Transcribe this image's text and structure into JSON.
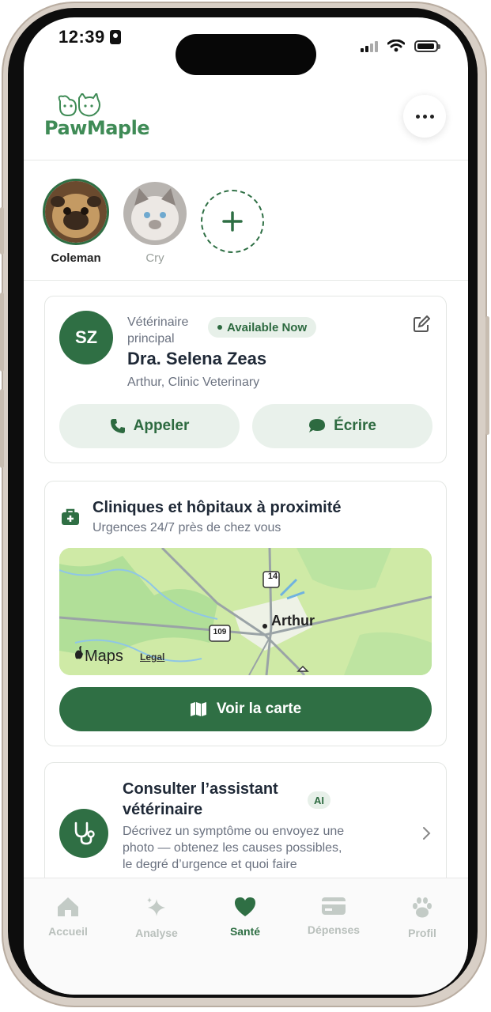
{
  "status_bar": {
    "time": "12:39"
  },
  "header": {
    "logo_text": "PawMaple"
  },
  "pets": [
    {
      "name": "Coleman",
      "selected": true
    },
    {
      "name": "Cry",
      "selected": false
    }
  ],
  "vet_card": {
    "initials": "SZ",
    "role_line1": "Vétérinaire",
    "role_line2": "principal",
    "availability": "Available Now",
    "name": "Dra. Selena Zeas",
    "clinic": "Arthur, Clinic Veterinary",
    "call_label": "Appeler",
    "write_label": "Écrire"
  },
  "clinics_card": {
    "title": "Cliniques et hôpitaux à proximité",
    "subtitle": "Urgences 24/7 près de chez vous",
    "map": {
      "town_label": "Arthur",
      "route_14": "14",
      "route_109": "109",
      "maps_brand": "Maps",
      "legal_label": "Legal"
    },
    "map_button_label": "Voir la carte"
  },
  "assistant_card": {
    "title_line1": "Consulter l’assistant",
    "title_line2": "vétérinaire",
    "badge": "AI",
    "desc_line1": "Décrivez un symptôme ou envoyez une",
    "desc_line2": "photo — obtenez les causes possibles,",
    "desc_line3": "le degré d’urgence et quoi faire"
  },
  "tab_bar": {
    "tabs": [
      {
        "label": "Accueil",
        "icon": "home-icon",
        "active": false
      },
      {
        "label": "Analyse",
        "icon": "sparkle-icon",
        "active": false
      },
      {
        "label": "Santé",
        "icon": "heart-icon",
        "active": true
      },
      {
        "label": "Dépenses",
        "icon": "card-icon",
        "active": false
      },
      {
        "label": "Profil",
        "icon": "paw-icon",
        "active": false
      }
    ]
  },
  "colors": {
    "brand_green": "#2f6f44",
    "light_green": "#e9f1eb",
    "inactive_tab": "#b9c0bc"
  }
}
